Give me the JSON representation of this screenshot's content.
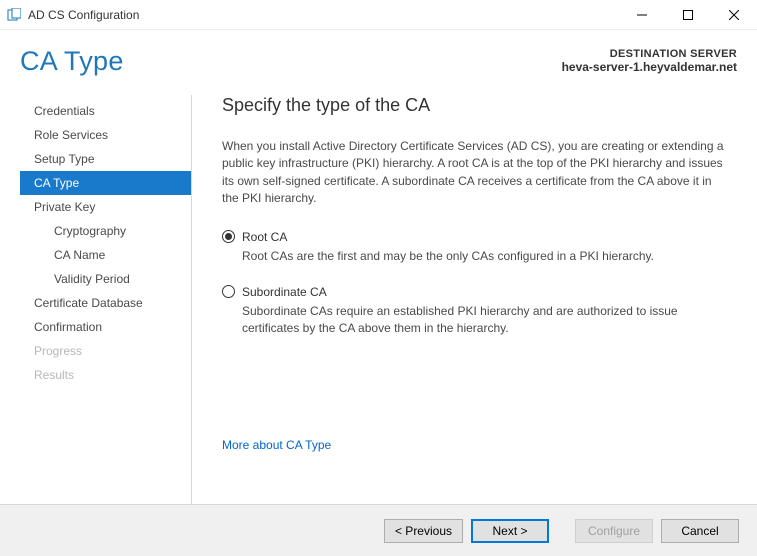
{
  "titlebar": {
    "title": "AD CS Configuration"
  },
  "header": {
    "title": "CA Type",
    "dest_label": "DESTINATION SERVER",
    "dest_server": "heva-server-1.heyvaldemar.net"
  },
  "sidebar": {
    "items": [
      {
        "label": "Credentials",
        "sub": false,
        "selected": false,
        "disabled": false
      },
      {
        "label": "Role Services",
        "sub": false,
        "selected": false,
        "disabled": false
      },
      {
        "label": "Setup Type",
        "sub": false,
        "selected": false,
        "disabled": false
      },
      {
        "label": "CA Type",
        "sub": false,
        "selected": true,
        "disabled": false
      },
      {
        "label": "Private Key",
        "sub": false,
        "selected": false,
        "disabled": false
      },
      {
        "label": "Cryptography",
        "sub": true,
        "selected": false,
        "disabled": false
      },
      {
        "label": "CA Name",
        "sub": true,
        "selected": false,
        "disabled": false
      },
      {
        "label": "Validity Period",
        "sub": true,
        "selected": false,
        "disabled": false
      },
      {
        "label": "Certificate Database",
        "sub": false,
        "selected": false,
        "disabled": false
      },
      {
        "label": "Confirmation",
        "sub": false,
        "selected": false,
        "disabled": false
      },
      {
        "label": "Progress",
        "sub": false,
        "selected": false,
        "disabled": true
      },
      {
        "label": "Results",
        "sub": false,
        "selected": false,
        "disabled": true
      }
    ]
  },
  "content": {
    "heading": "Specify the type of the CA",
    "intro": "When you install Active Directory Certificate Services (AD CS), you are creating or extending a public key infrastructure (PKI) hierarchy. A root CA is at the top of the PKI hierarchy and issues its own self-signed certificate. A subordinate CA receives a certificate from the CA above it in the PKI hierarchy.",
    "options": [
      {
        "label": "Root CA",
        "checked": true,
        "desc": "Root CAs are the first and may be the only CAs configured in a PKI hierarchy."
      },
      {
        "label": "Subordinate CA",
        "checked": false,
        "desc": "Subordinate CAs require an established PKI hierarchy and are authorized to issue certificates by the CA above them in the hierarchy."
      }
    ],
    "more_link": "More about CA Type"
  },
  "footer": {
    "previous": "< Previous",
    "next": "Next >",
    "configure": "Configure",
    "cancel": "Cancel"
  }
}
